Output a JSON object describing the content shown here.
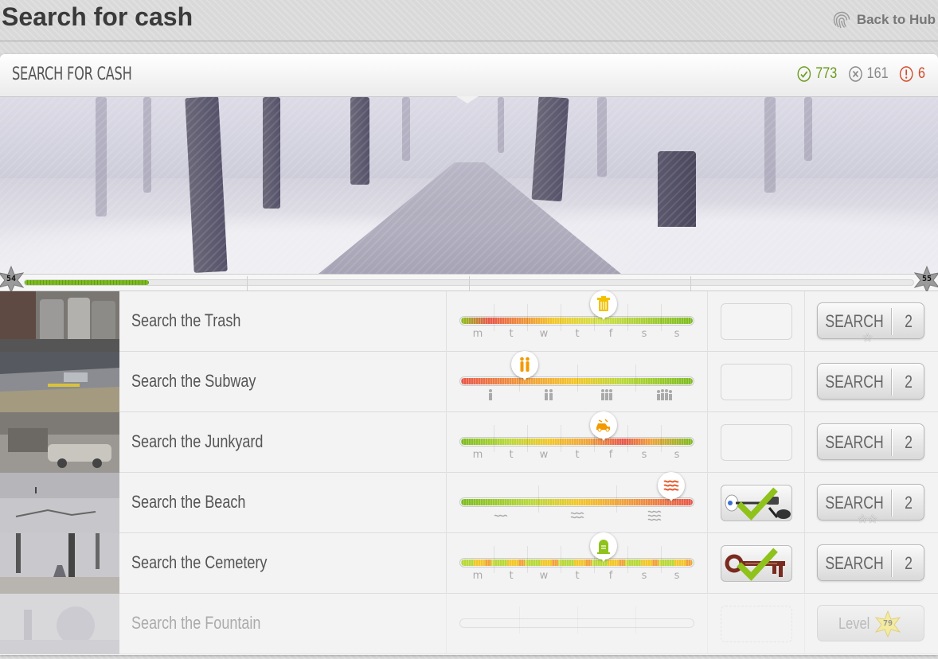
{
  "page": {
    "title": "Search for cash",
    "back_label": "Back to Hub"
  },
  "panel": {
    "title": "SEARCH FOR CASH",
    "stats": {
      "success": "773",
      "failed": "161",
      "warnings": "6"
    }
  },
  "xp": {
    "current_level": "54",
    "next_level": "55",
    "progress": 0.14
  },
  "colors": {
    "success": "#6a9a1e",
    "fail": "#888888",
    "warn": "#d24a2b",
    "xp_fill": "#7cbb1f"
  },
  "rows": [
    {
      "name": "Search the Trash",
      "icon": "trash-icon",
      "pin_color": "#f2c200",
      "pin_pos": 0.61,
      "labels": [
        "m",
        "t",
        "w",
        "t",
        "f",
        "s",
        "s"
      ],
      "item": "",
      "button": "SEARCH",
      "cost": "2",
      "stars": "☆"
    },
    {
      "name": "Search the Subway",
      "icon": "people-icon",
      "pin_color": "#f29a00",
      "pin_pos": 0.27,
      "labels": [
        "person-1-icon",
        "person-2-icon",
        "person-3-icon",
        "person-4-icon"
      ],
      "item": "",
      "button": "SEARCH",
      "cost": "2",
      "stars": ""
    },
    {
      "name": "Search the Junkyard",
      "icon": "car-icon",
      "pin_color": "#f29a00",
      "pin_pos": 0.61,
      "labels": [
        "m",
        "t",
        "w",
        "t",
        "f",
        "s",
        "s"
      ],
      "item": "",
      "button": "SEARCH",
      "cost": "2",
      "stars": ""
    },
    {
      "name": "Search the Beach",
      "icon": "wave-icon",
      "pin_color": "#e85a2a",
      "pin_pos": 0.9,
      "labels": [
        "wave-1-icon",
        "wave-2-icon",
        "wave-3-icon"
      ],
      "item": "metal-detector-icon",
      "button": "SEARCH",
      "cost": "2",
      "stars": "☆☆"
    },
    {
      "name": "Search the Cemetery",
      "icon": "tombstone-icon",
      "pin_color": "#8fc21b",
      "pin_pos": 0.61,
      "labels": [
        "m",
        "t",
        "w",
        "t",
        "f",
        "s",
        "s"
      ],
      "item": "key-icon",
      "button": "SEARCH",
      "cost": "2",
      "stars": ""
    },
    {
      "name": "Search the Fountain",
      "locked": true,
      "button": "Level",
      "required_level": "79"
    }
  ]
}
